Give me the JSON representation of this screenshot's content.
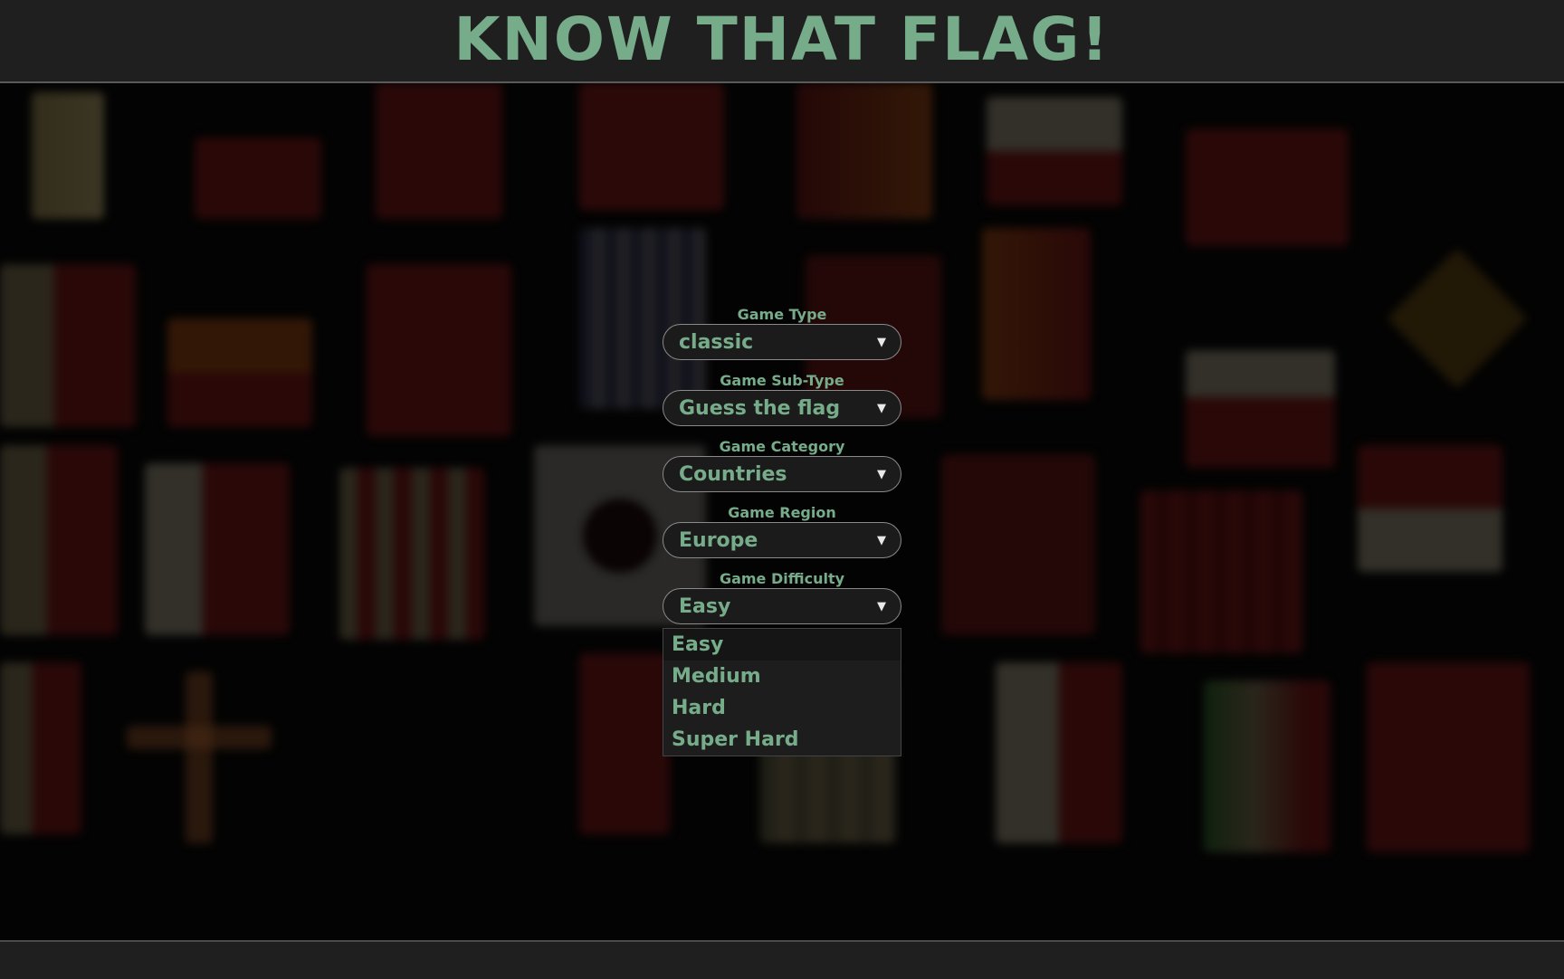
{
  "header": {
    "title": "KNOW THAT FLAG!"
  },
  "form": {
    "fields": [
      {
        "label": "Game Type",
        "value": "classic"
      },
      {
        "label": "Game Sub-Type",
        "value": "Guess the flag"
      },
      {
        "label": "Game Category",
        "value": "Countries"
      },
      {
        "label": "Game Region",
        "value": "Europe"
      },
      {
        "label": "Game Difficulty",
        "value": "Easy"
      }
    ],
    "arrow_icon": "▼"
  },
  "difficulty_dropdown": {
    "options": [
      "Easy",
      "Medium",
      "Hard",
      "Super Hard"
    ],
    "highlighted": "Easy"
  },
  "colors": {
    "accent": "#77ac8a",
    "header_bg": "#1f1f1f",
    "page_bg": "#050505"
  }
}
